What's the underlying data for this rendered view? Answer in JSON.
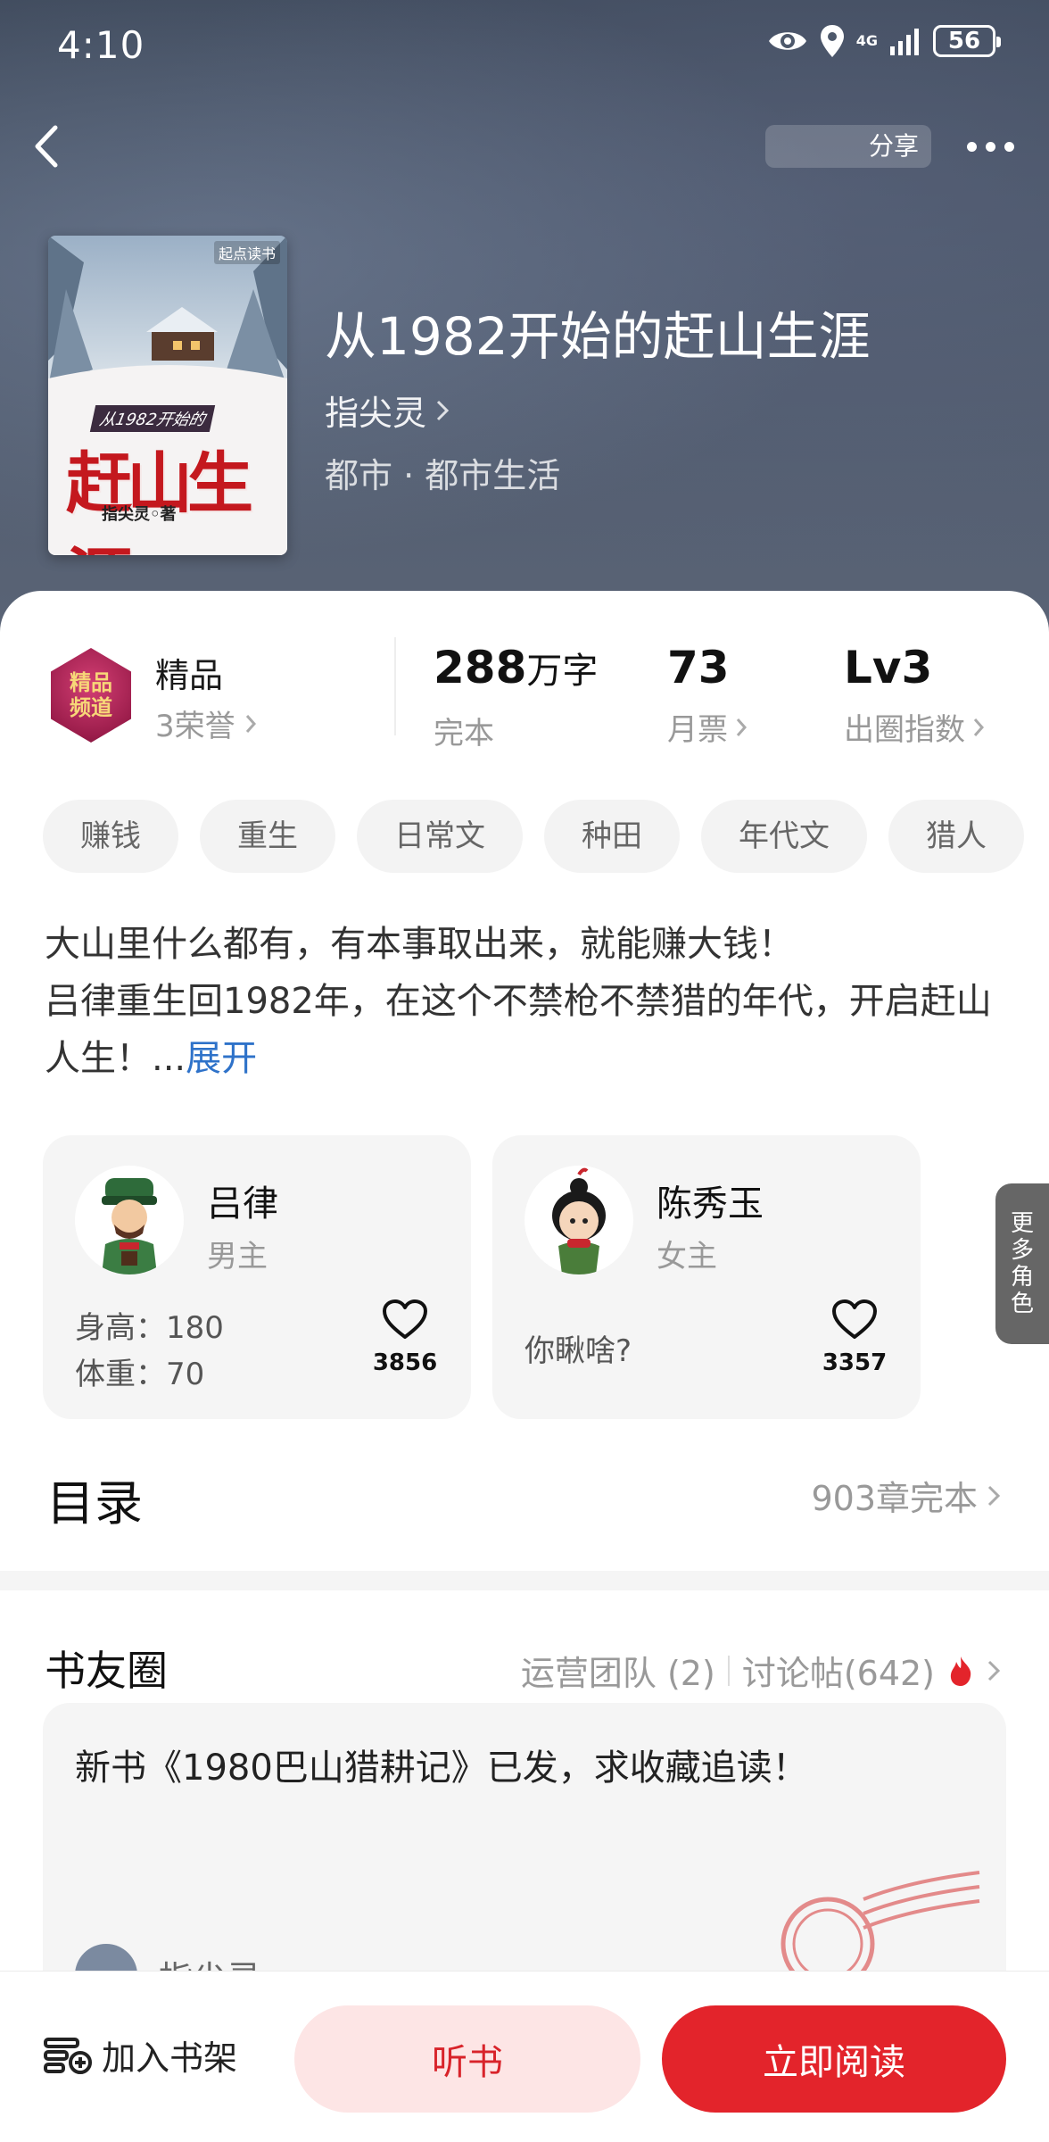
{
  "status_bar": {
    "time": "4:10",
    "network": "4G",
    "battery": "56"
  },
  "nav": {
    "share_label": "分享"
  },
  "book": {
    "cover_brand": "起点读书",
    "cover_subtitle": "从1982开始的",
    "cover_title": "赶山生涯",
    "cover_author": "指尖灵◦著",
    "title": "从1982开始的赶山生涯",
    "author": "指尖灵",
    "genre": "都市 · 都市生活"
  },
  "honor": {
    "badge_text": "精品频道",
    "title": "精品",
    "subtitle": "3荣誉"
  },
  "stats": [
    {
      "value": "288",
      "unit": "万字",
      "label": "完本",
      "has_arrow": false
    },
    {
      "value": "73",
      "unit": "",
      "label": "月票",
      "has_arrow": true
    },
    {
      "value": "Lv3",
      "unit": "",
      "label": "出圈指数",
      "has_arrow": true
    }
  ],
  "tags": [
    "赚钱",
    "重生",
    "日常文",
    "种田",
    "年代文",
    "猎人"
  ],
  "synopsis": {
    "line1": "大山里什么都有，有本事取出来，就能赚大钱！",
    "line2": "吕律重生回1982年，在这个不禁枪不禁猎的年代，开启赶山人生！...",
    "expand": "展开"
  },
  "characters": [
    {
      "name": "吕律",
      "role": "男主",
      "desc_lines": [
        "身高：180",
        "体重：70"
      ],
      "likes": "3856"
    },
    {
      "name": "陈秀玉",
      "role": "女主",
      "desc_lines": [
        "你瞅啥?"
      ],
      "likes": "3357"
    }
  ],
  "more_roles": "更多角色",
  "toc": {
    "title": "目录",
    "summary": "903章完本"
  },
  "circle": {
    "title": "书友圈",
    "team": "运营团队 (2)",
    "posts": "讨论帖(642)",
    "post_text": "新书《1980巴山猎耕记》已发，求收藏追读！",
    "post_author": "指尖灵"
  },
  "bottom": {
    "shelf": "加入书架",
    "listen": "听书",
    "read": "立即阅读"
  },
  "colors": {
    "accent": "#e3242b",
    "link": "#2e72c9",
    "header": "#4d586b"
  }
}
